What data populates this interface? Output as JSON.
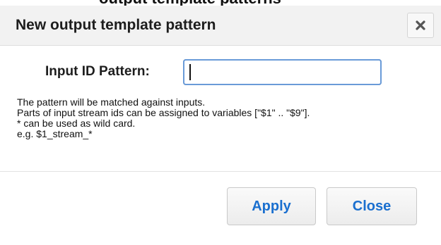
{
  "background": {
    "header_fragment": "output template patterns"
  },
  "dialog": {
    "title": "New output template pattern",
    "close_icon": "close-icon",
    "field": {
      "label": "Input ID Pattern:",
      "value": "",
      "placeholder": ""
    },
    "help_lines": [
      "The pattern will be matched against inputs.",
      "Parts of input stream ids can be assigned to variables [\"$1\" .. \"$9\"].",
      "* can be used as wild card.",
      "e.g. $1_stream_*"
    ],
    "buttons": {
      "apply_label": "Apply",
      "close_label": "Close"
    }
  },
  "colors": {
    "titlebar_bg": "#f2f2f2",
    "button_text": "#1a6fcf",
    "input_focus": "#6a9bd8"
  }
}
